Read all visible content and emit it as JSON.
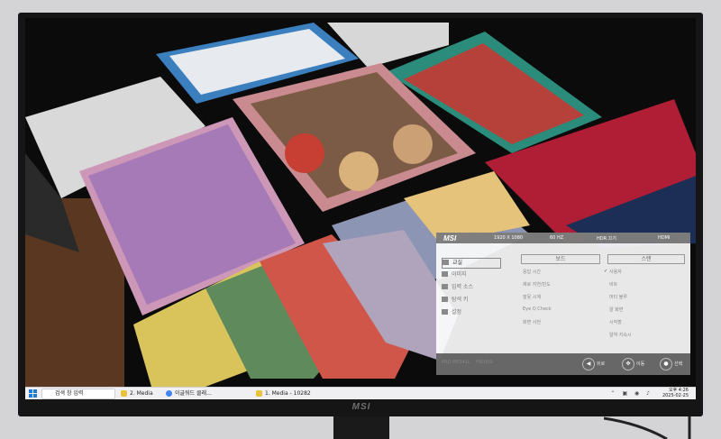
{
  "osd": {
    "brand": "MSI",
    "status": [
      "1920 X 1080",
      "60 HZ",
      "HDR 끄기",
      "HDMI"
    ],
    "menu": [
      {
        "label": "교실",
        "icon": "game-icon",
        "active": true
      },
      {
        "label": "이미지",
        "icon": "image-icon",
        "active": false
      },
      {
        "label": "입력 소스",
        "icon": "input-icon",
        "active": false
      },
      {
        "label": "탐색 키",
        "icon": "navi-key-icon",
        "active": false
      },
      {
        "label": "설정",
        "icon": "settings-icon",
        "active": false
      }
    ],
    "col2_header": "보드",
    "col3_header": "스탠",
    "col2_rows": [
      "응답 시간",
      "제로 지연/빈도",
      "잘못 시계",
      "Eye Q Check",
      "화면 사전"
    ],
    "col3_rows": [
      "사용자",
      "비트",
      "머티 블루",
      "알 화면",
      "시작할",
      "알약 지속시"
    ],
    "model": "PRO MP241L",
    "fw": "FW.009",
    "nav": [
      {
        "label": "뒤로",
        "icon": "back-icon"
      },
      {
        "label": "이동",
        "icon": "move-icon"
      },
      {
        "label": "선택",
        "icon": "select-icon"
      }
    ]
  },
  "taskbar": {
    "search": "검색 창 입력",
    "apps": [
      {
        "label": "2. Media",
        "color": "#e8c33a"
      },
      {
        "label": "이글워드 클래…",
        "color": "#4285f4"
      },
      {
        "label": "1. Media - 10282",
        "color": "#e8c33a"
      }
    ],
    "clock_time": "오후 4:26",
    "clock_date": "2025-02-25"
  },
  "bezel_logo": "MSI"
}
